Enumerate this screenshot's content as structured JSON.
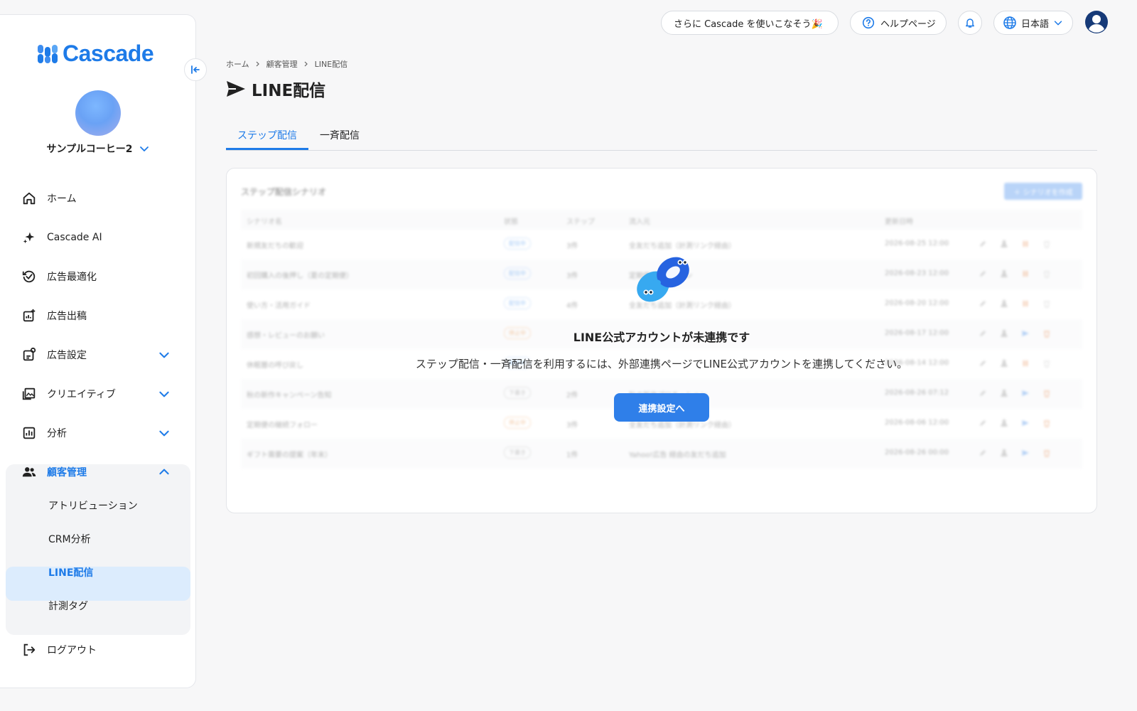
{
  "app": {
    "brand": "Cascade",
    "brand_color": "#1e7be8"
  },
  "topbar": {
    "promo_label": "さらに Cascade を使いこなそう🎉",
    "help_label": "ヘルプページ",
    "language_label": "日本語"
  },
  "sidebar": {
    "account_name": "サンプルコーヒー2",
    "items": [
      {
        "label": "ホーム",
        "icon": "home-icon"
      },
      {
        "label": "Cascade AI",
        "icon": "sparkle-icon"
      },
      {
        "label": "広告最適化",
        "icon": "optimize-icon"
      },
      {
        "label": "広告出稿",
        "icon": "publish-icon"
      },
      {
        "label": "広告設定",
        "icon": "settings-icon"
      },
      {
        "label": "クリエイティブ",
        "icon": "image-icon"
      },
      {
        "label": "分析",
        "icon": "chart-icon"
      },
      {
        "label": "顧客管理",
        "icon": "users-icon"
      }
    ],
    "sub_items": [
      {
        "label": "アトリビューション"
      },
      {
        "label": "CRM分析"
      },
      {
        "label": "LINE配信",
        "active": true
      },
      {
        "label": "計測タグ"
      }
    ],
    "logout_label": "ログアウト"
  },
  "breadcrumb": [
    "ホーム",
    "顧客管理",
    "LINE配信"
  ],
  "page": {
    "title": "LINE配信"
  },
  "tabs": [
    {
      "label": "ステップ配信",
      "active": true
    },
    {
      "label": "一斉配信",
      "active": false
    }
  ],
  "card": {
    "title": "ステップ配信シナリオ",
    "create_label": "＋ シナリオを作成",
    "columns": [
      "シナリオ名",
      "状態",
      "ステップ",
      "流入元",
      "更新日時"
    ],
    "rows": [
      {
        "name": "新規友だちの歓迎",
        "status": "配信中",
        "status_type": "active",
        "steps": "3件",
        "source": "全友だち追加（計測リンク経由）",
        "updated": "2026-08-25 12:00"
      },
      {
        "name": "初回購入の後押し（夏の定期便）",
        "status": "配信中",
        "status_type": "active",
        "steps": "3件",
        "source": "定期便キャンペーン",
        "updated": "2026-08-23 12:00"
      },
      {
        "name": "使い方・活用ガイド",
        "status": "配信中",
        "status_type": "active",
        "steps": "4件",
        "source": "全友だち追加（計測リンク経由）",
        "updated": "2026-08-20 12:00"
      },
      {
        "name": "感想・レビューのお願い",
        "status": "停止中",
        "status_type": "paused",
        "steps": "",
        "source": "",
        "updated": "2026-08-17 12:00"
      },
      {
        "name": "休眠層の呼び戻し",
        "status": "配信中",
        "status_type": "active",
        "steps": "",
        "source": "",
        "updated": "2026-08-14 12:00"
      },
      {
        "name": "秋の新作キャンペーン告知",
        "status": "下書き",
        "status_type": "draft",
        "steps": "2件",
        "source": "秋の新作プロモーション",
        "updated": "2026-08-26 07:12"
      },
      {
        "name": "定期便の継続フォロー",
        "status": "停止中",
        "status_type": "paused",
        "steps": "3件",
        "source": "全友だち追加（計測リンク経由）",
        "updated": "2026-08-06 12:00"
      },
      {
        "name": "ギフト需要の提案（年末）",
        "status": "下書き",
        "status_type": "draft",
        "steps": "1件",
        "source": "Yahoo!広告 経由の友だち追加",
        "updated": "2026-08-26 00:00"
      }
    ]
  },
  "overlay": {
    "title": "LINE公式アカウントが未連携です",
    "message": "ステップ配信・一斉配信を利用するには、外部連携ページでLINE公式アカウントを連携してください。",
    "button_label": "連携設定へ"
  },
  "colors": {
    "accent": "#1e7be8",
    "active_bg": "#dcecfd",
    "button": "#2f7fe9"
  }
}
